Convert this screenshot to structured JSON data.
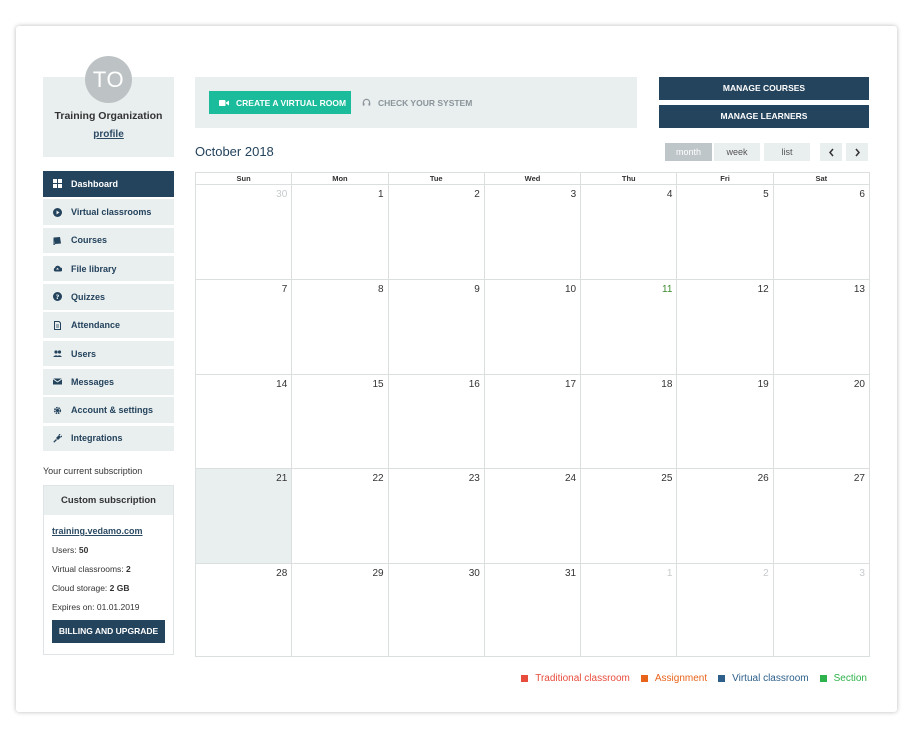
{
  "profile": {
    "initials": "TO",
    "org_name": "Training Organization",
    "profile_link": "profile"
  },
  "nav": {
    "items": [
      {
        "label": "Dashboard",
        "icon": "dashboard-grid-icon",
        "active": true
      },
      {
        "label": "Virtual classrooms",
        "icon": "play-circle-icon"
      },
      {
        "label": "Courses",
        "icon": "book-icon"
      },
      {
        "label": "File library",
        "icon": "cloud-upload-icon"
      },
      {
        "label": "Quizzes",
        "icon": "question-circle-icon"
      },
      {
        "label": "Attendance",
        "icon": "document-icon"
      },
      {
        "label": "Users",
        "icon": "users-icon"
      },
      {
        "label": "Messages",
        "icon": "envelope-icon"
      },
      {
        "label": "Account & settings",
        "icon": "gear-icon"
      },
      {
        "label": "Integrations",
        "icon": "plug-icon"
      }
    ]
  },
  "subscription": {
    "caption": "Your current subscription",
    "title": "Custom subscription",
    "link": "training.vedamo.com",
    "users_label": "Users: ",
    "users_value": "50",
    "classrooms_label": "Virtual classrooms: ",
    "classrooms_value": "2",
    "storage_label": "Cloud storage: ",
    "storage_value": "2 GB",
    "expires": "Expires on: 01.01.2019",
    "billing_button": "BILLING AND UPGRADE"
  },
  "actions": {
    "create_room": "CREATE A VIRTUAL ROOM",
    "check_system": "CHECK YOUR SYSTEM",
    "manage_courses": "MANAGE COURSES",
    "manage_learners": "MANAGE LEARNERS"
  },
  "calendar": {
    "title": "October 2018",
    "views": [
      "month",
      "week",
      "list"
    ],
    "active_view": "month",
    "weekdays": [
      "Sun",
      "Mon",
      "Tue",
      "Wed",
      "Thu",
      "Fri",
      "Sat"
    ],
    "weeks": [
      [
        {
          "d": "30",
          "other": true
        },
        {
          "d": "1"
        },
        {
          "d": "2"
        },
        {
          "d": "3"
        },
        {
          "d": "4"
        },
        {
          "d": "5"
        },
        {
          "d": "6"
        }
      ],
      [
        {
          "d": "7"
        },
        {
          "d": "8"
        },
        {
          "d": "9"
        },
        {
          "d": "10"
        },
        {
          "d": "11",
          "green": true
        },
        {
          "d": "12"
        },
        {
          "d": "13"
        }
      ],
      [
        {
          "d": "14"
        },
        {
          "d": "15"
        },
        {
          "d": "16"
        },
        {
          "d": "17"
        },
        {
          "d": "18"
        },
        {
          "d": "19"
        },
        {
          "d": "20"
        }
      ],
      [
        {
          "d": "21",
          "today": true
        },
        {
          "d": "22"
        },
        {
          "d": "23"
        },
        {
          "d": "24"
        },
        {
          "d": "25"
        },
        {
          "d": "26"
        },
        {
          "d": "27"
        }
      ],
      [
        {
          "d": "28"
        },
        {
          "d": "29"
        },
        {
          "d": "30"
        },
        {
          "d": "31"
        },
        {
          "d": "1",
          "other": true
        },
        {
          "d": "2",
          "other": true
        },
        {
          "d": "3",
          "other": true
        }
      ]
    ]
  },
  "legend": [
    {
      "label": "Traditional classroom",
      "color": "#e74c3c"
    },
    {
      "label": "Assignment",
      "color": "#e8641b"
    },
    {
      "label": "Virtual classroom",
      "color": "#2c5f8a"
    },
    {
      "label": "Section",
      "color": "#2eb24b"
    }
  ],
  "colors": {
    "primary": "#24435c",
    "accent": "#1abc9c",
    "panel": "#e9eeef"
  }
}
